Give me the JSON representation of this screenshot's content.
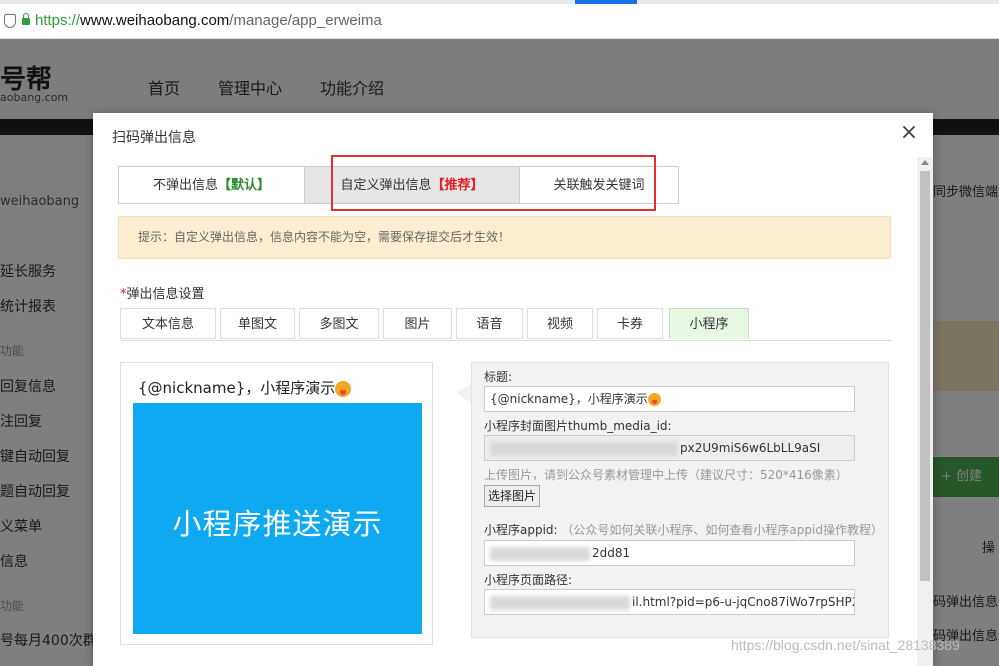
{
  "browser": {
    "url_scheme": "https://",
    "url_host": "www.weihaobang.com",
    "url_path": "/manage/app_erweima"
  },
  "site": {
    "logo": "号帮",
    "logo_sub": "aobang.com",
    "nav": [
      "首页",
      "管理中心",
      "功能介绍"
    ],
    "account": "weihaobang",
    "sidebar": [
      "延长服务",
      "统计报表",
      "功能",
      "回复信息",
      "注回复",
      "键自动回复",
      "题自动回复",
      "义菜单",
      "信息",
      "功能",
      "号每月400次群发"
    ],
    "right_texts": [
      "同步微信端",
      "创建",
      "操",
      "码弹出信息",
      "码弹出信息"
    ]
  },
  "modal": {
    "title": "扫码弹出信息",
    "close_label": "×",
    "mode_tabs": [
      {
        "label": "不弹出信息",
        "tag": "【默认】"
      },
      {
        "label": "自定义弹出信息",
        "tag": "【推荐】"
      },
      {
        "label": "关联触发关键词",
        "tag": ""
      }
    ],
    "tip": "提示：自定义弹出信息，信息内容不能为空，需要保存提交后才生效！",
    "section_required": "*",
    "section_label": "弹出信息设置",
    "type_tabs": [
      "文本信息",
      "单图文",
      "多图文",
      "图片",
      "语音",
      "视频",
      "卡券",
      "小程序"
    ],
    "active_type": "小程序",
    "preview": {
      "title": "{@nickname}，小程序演示",
      "image_text": "小程序推送演示"
    },
    "form": {
      "title_label": "标题:",
      "title_value": "{@nickname}，小程序演示",
      "thumb_label": "小程序封面图片thumb_media_id:",
      "thumb_value": "px2U9miS6w6LbLL9aSI",
      "upload_hint": "上传图片，请到公众号素材管理中上传（建议尺寸：520*416像素）",
      "choose_button": "选择图片",
      "appid_label": "小程序appid:",
      "appid_note": "（公众号如何关联小程序、如何查看小程序appid操作教程）",
      "appid_value": "2dd81",
      "path_label": "小程序页面路径:",
      "path_value": "il.html?pid=p6-u-jqCno87iWo7rpSHP2"
    }
  },
  "watermark": "https://blog.csdn.net/sinat_28138389",
  "colors": {
    "preview_blue": "#0ea9f0",
    "recommend_red": "#e02020",
    "default_green": "#2e8b2e",
    "highlight_box": "#e03030"
  }
}
